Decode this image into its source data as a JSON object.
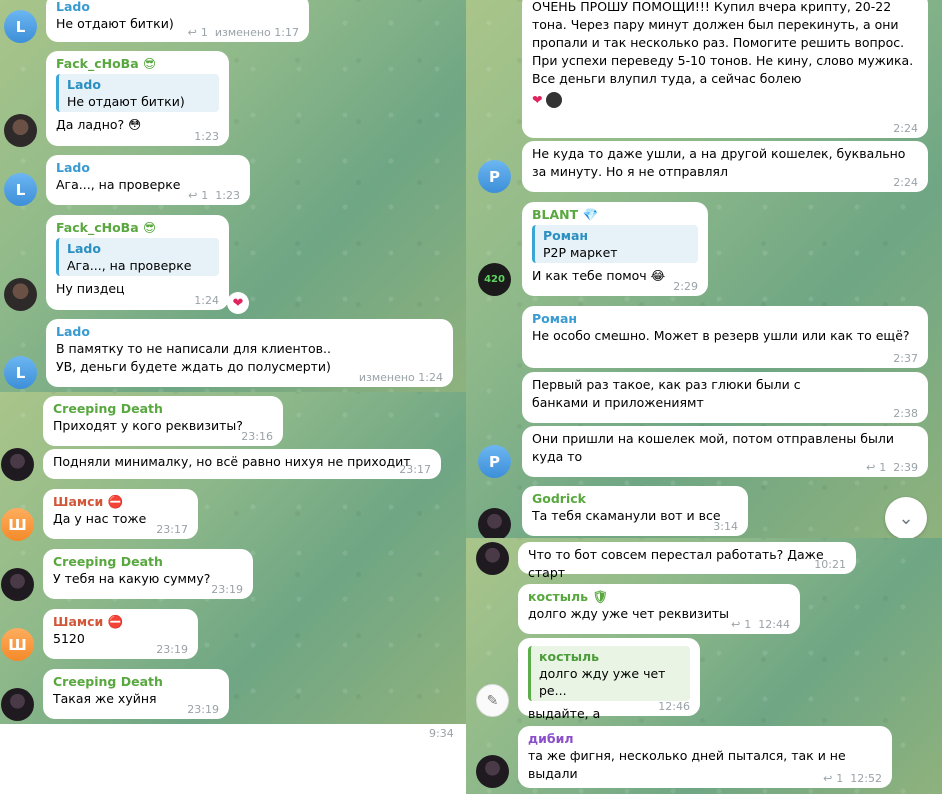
{
  "panel1": {
    "messages": [
      {
        "name": "Lado",
        "text": "Не отдают битки)",
        "fwd": "1",
        "time": "изменено 1:17"
      },
      {
        "name": "Fack_cHoBa",
        "emoji": "😎",
        "quote_name": "Lado",
        "quote_text": "Не отдают битки)",
        "text": "Да ладно?",
        "text_emoji": "😳",
        "time": "1:23"
      },
      {
        "name": "Lado",
        "text": "Ага..., на проверке",
        "fwd": "1",
        "time": "1:23"
      },
      {
        "name": "Fack_cHoBa",
        "emoji": "😎",
        "quote_name": "Lado",
        "quote_text": "Ага..., на проверке",
        "text": "Ну пиздец",
        "time": "1:24",
        "reaction": "❤"
      },
      {
        "name": "Lado",
        "text": "В памятку то не написали для клиентов.. УВ, деньги будете ждать до полусмерти)",
        "time": "изменено 1:24"
      }
    ],
    "avatar_letter": "L"
  },
  "panel2": {
    "messages": [
      {
        "name": "Creeping Death",
        "text": "Приходят у кого реквизиты?",
        "time": "23:16"
      },
      {
        "text": "Подняли минималку, но всё равно нихуя не приходит",
        "time": "23:17"
      },
      {
        "name": "Шамси",
        "emoji": "⛔",
        "text": "Да у нас тоже",
        "time": "23:17"
      },
      {
        "name": "Creeping Death",
        "text": "У тебя на какую сумму?",
        "time": "23:19"
      },
      {
        "name": "Шамси",
        "emoji": "⛔",
        "text": "5120",
        "time": "23:19"
      },
      {
        "name": "Creeping Death",
        "text": "Такая же хуйня",
        "time": "23:19"
      }
    ],
    "avatar_letter": "Ш",
    "footer_time": "9:34"
  },
  "panel3": {
    "messages": [
      {
        "text": "ОЧЕНЬ ПРОШУ ПОМОЩИ!!! Купил вчера крипту, 20-22 тона. Через пару минут должен был перекинуть, а они пропали и так несколько раз. Помогите решить вопрос. При успехи переведу 5-10 тонов. Не кину, слово мужика. Все деньги влупил туда, а сейчас болею",
        "reaction": "❤",
        "time": "2:24"
      },
      {
        "text": "Не куда то даже ушли, а на другой кошелек, буквально за минуту. Но я не отправлял",
        "time": "2:24"
      },
      {
        "name": "BLANT",
        "emoji": "💎",
        "quote_name": "Роман",
        "quote_text": "P2P маркет",
        "text": "И как тебе помоч",
        "text_emoji": "😂",
        "time": "2:29"
      },
      {
        "name": "Роман",
        "text": "Не особо смешно. Может в резерв ушли или как то ещё?",
        "time": "2:37"
      },
      {
        "text": "Первый раз такое, как раз глюки были с банками и приложениямт",
        "time": "2:38"
      },
      {
        "text": "Они пришли на кошелек мой, потом отправлены были куда то",
        "fwd": "1",
        "time": "2:39"
      },
      {
        "name": "Godrick",
        "text": "Та тебя скаманули вот и все",
        "time": "3:14"
      }
    ],
    "avatar_letter": "Р",
    "avatar_logo": "420",
    "scroll_icon": "chevron-down-icon"
  },
  "panel4": {
    "messages": [
      {
        "text": "Что то бот совсем перестал работать? Даже старт",
        "time": "10:21"
      },
      {
        "name": "костыль",
        "emoji": "🛡",
        "text": "долго жду уже чет реквизиты",
        "fwd": "1",
        "time": "12:44"
      },
      {
        "quote_name": "костыль",
        "quote_text": "долго жду уже чет ре...",
        "text": "выдайте, а",
        "time": "12:46"
      },
      {
        "name": "дибил",
        "text": "та же фигня, несколько дней пытался, так и не выдали",
        "fwd": "1",
        "time": "12:52"
      }
    ]
  },
  "colors": {
    "name_blue": "#3a9bd0",
    "name_green": "#58a83f",
    "name_red": "#d1573a",
    "name_purple": "#8a4fc9",
    "meta": "#9aa3a8"
  }
}
